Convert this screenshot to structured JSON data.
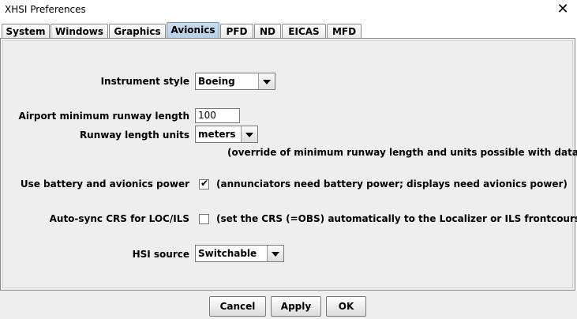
{
  "window": {
    "title": "XHSI Preferences",
    "close_glyph": "✕"
  },
  "tabs": [
    {
      "label": "System",
      "active": false
    },
    {
      "label": "Windows",
      "active": false
    },
    {
      "label": "Graphics",
      "active": false
    },
    {
      "label": "Avionics",
      "active": true
    },
    {
      "label": "PFD",
      "active": false
    },
    {
      "label": "ND",
      "active": false
    },
    {
      "label": "EICAS",
      "active": false
    },
    {
      "label": "MFD",
      "active": false
    }
  ],
  "avionics": {
    "instrument_style": {
      "label": "Instrument style",
      "value": "Boeing"
    },
    "min_runway_length": {
      "label": "Airport minimum runway length",
      "value": "100"
    },
    "runway_units": {
      "label": "Runway length units",
      "value": "meters"
    },
    "runway_note": "(override of minimum runway length and units possible with datarefs)",
    "battery_power": {
      "label": "Use battery and avionics power",
      "checked": true,
      "mark": "✔",
      "note": "(annunciators need battery power; displays need avionics power)"
    },
    "auto_sync_crs": {
      "label": "Auto-sync CRS for LOC/ILS",
      "checked": false,
      "mark": "",
      "note": "(set the CRS (=OBS) automatically to the Localizer or ILS frontcourse)"
    },
    "hsi_source": {
      "label": "HSI source",
      "value": "Switchable"
    }
  },
  "buttons": {
    "cancel": "Cancel",
    "apply": "Apply",
    "ok": "OK"
  }
}
